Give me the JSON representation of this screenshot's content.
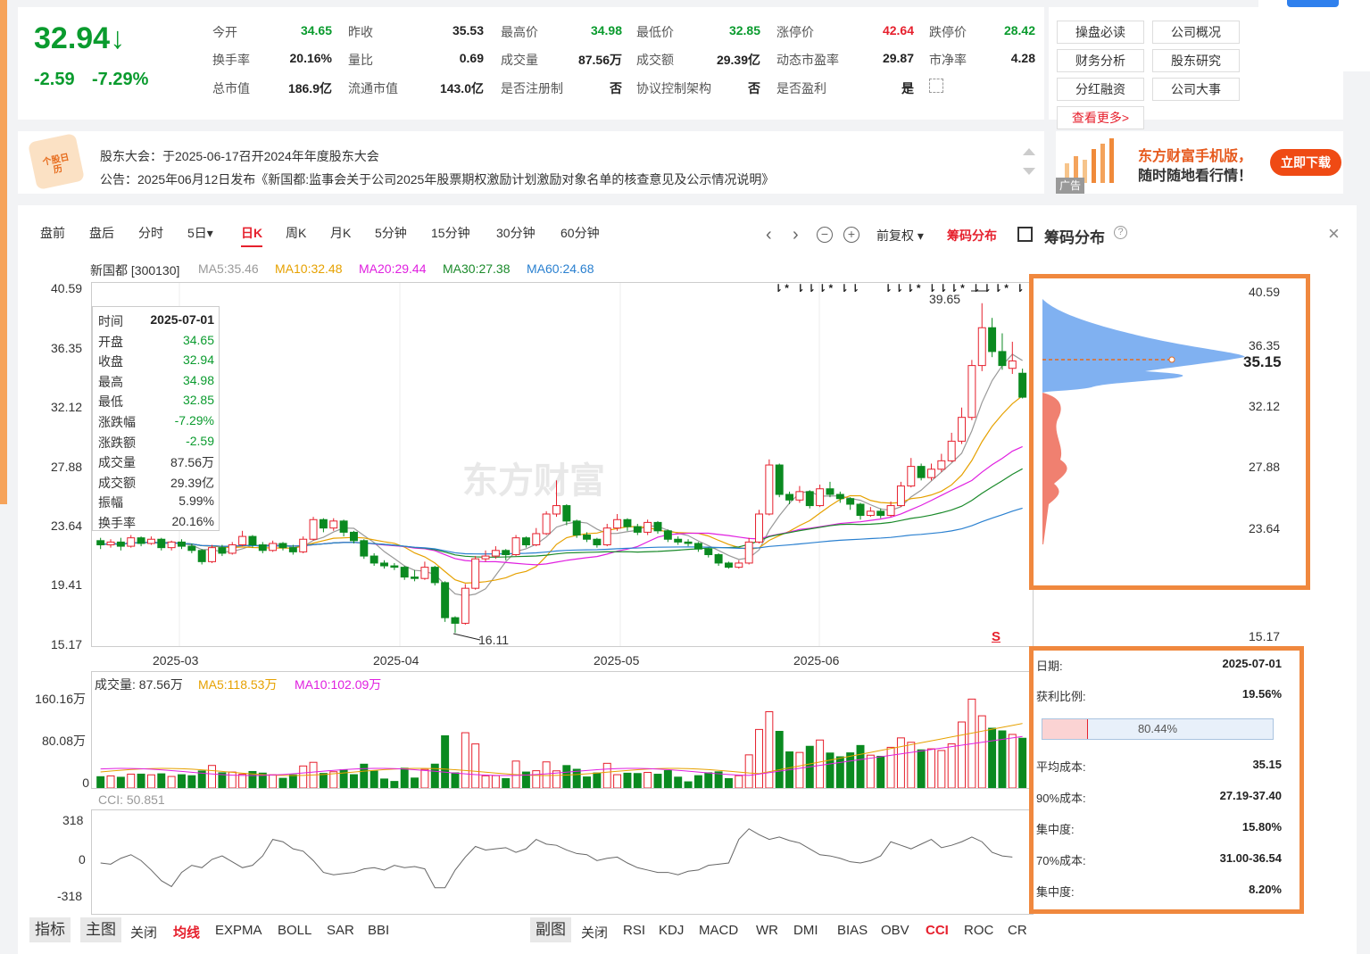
{
  "quote": {
    "price": "32.94↓",
    "change": "-2.59",
    "change_pct": "-7.29%",
    "fields": [
      {
        "label": "今开",
        "value": "34.65",
        "color": "#0a9b2e"
      },
      {
        "label": "昨收",
        "value": "35.53",
        "color": "#222"
      },
      {
        "label": "最高价",
        "value": "34.98",
        "color": "#0a9b2e"
      },
      {
        "label": "最低价",
        "value": "32.85",
        "color": "#0a9b2e"
      },
      {
        "label": "涨停价",
        "value": "42.64",
        "color": "#e6202d"
      },
      {
        "label": "跌停价",
        "value": "28.42",
        "color": "#0a9b2e"
      },
      {
        "label": "换手率",
        "value": "20.16%",
        "color": "#222"
      },
      {
        "label": "量比",
        "value": "0.69",
        "color": "#222"
      },
      {
        "label": "成交量",
        "value": "87.56万",
        "color": "#222"
      },
      {
        "label": "成交额",
        "value": "29.39亿",
        "color": "#222"
      },
      {
        "label": "动态市盈率",
        "value": "29.87",
        "color": "#222"
      },
      {
        "label": "市净率",
        "value": "4.28",
        "color": "#222"
      },
      {
        "label": "总市值",
        "value": "186.9亿",
        "color": "#222"
      },
      {
        "label": "流通市值",
        "value": "143.0亿",
        "color": "#222"
      },
      {
        "label": "是否注册制",
        "value": "否",
        "color": "#222"
      },
      {
        "label": "协议控制架构",
        "value": "否",
        "color": "#222"
      },
      {
        "label": "是否盈利",
        "value": "是",
        "color": "#222"
      }
    ]
  },
  "quick_links": [
    "操盘必读",
    "公司概况",
    "财务分析",
    "股东研究",
    "分红融资",
    "公司大事",
    "查看更多>"
  ],
  "notice": {
    "icon_text": "个股日历",
    "line1": "股东大会：于2025-06-17召开2024年年度股东大会",
    "line2": "公告：2025年06月12日发布《新国都:监事会关于公司2025年股票期权激励计划激励对象名单的核查意见及公示情况说明》"
  },
  "ad": {
    "title": "东方财富手机版，",
    "subtitle": "随时随地看行情！",
    "button": "立即下载",
    "tag": "广告"
  },
  "chart_tabs": [
    "盘前",
    "盘后",
    "分时",
    "5日▾",
    "日K",
    "周K",
    "月K",
    "5分钟",
    "15分钟",
    "30分钟",
    "60分钟"
  ],
  "active_tab": "日K",
  "chart_toolbar": {
    "adjust": "前复权 ▾",
    "chip_link": "筹码分布",
    "chip_title": "筹码分布"
  },
  "ma_legend": {
    "stock": "新国都 [300130]",
    "ma5": "MA5:35.46",
    "ma10": "MA10:32.48",
    "ma20": "MA20:29.44",
    "ma30": "MA30:27.38",
    "ma60": "MA60:24.68"
  },
  "price_axis": [
    "40.59",
    "36.35",
    "32.12",
    "27.88",
    "23.64",
    "19.41",
    "15.17"
  ],
  "date_axis": [
    "2025-03",
    "2025-04",
    "2025-05",
    "2025-06"
  ],
  "annotations": {
    "high": "39.65",
    "low": "16.11",
    "signal": "S"
  },
  "watermark": "东方财富",
  "tooltip": [
    {
      "k": "时间",
      "v": "2025-07-01",
      "c": "#222"
    },
    {
      "k": "开盘",
      "v": "34.65",
      "c": "#0a9b2e"
    },
    {
      "k": "收盘",
      "v": "32.94",
      "c": "#0a9b2e"
    },
    {
      "k": "最高",
      "v": "34.98",
      "c": "#0a9b2e"
    },
    {
      "k": "最低",
      "v": "32.85",
      "c": "#0a9b2e"
    },
    {
      "k": "涨跌幅",
      "v": "-7.29%",
      "c": "#0a9b2e"
    },
    {
      "k": "涨跌额",
      "v": "-2.59",
      "c": "#0a9b2e"
    },
    {
      "k": "成交量",
      "v": "87.56万",
      "c": "#333"
    },
    {
      "k": "成交额",
      "v": "29.39亿",
      "c": "#333"
    },
    {
      "k": "振幅",
      "v": "5.99%",
      "c": "#333"
    },
    {
      "k": "换手率",
      "v": "20.16%",
      "c": "#333"
    }
  ],
  "volume": {
    "legend": "成交量: 87.56万",
    "ma5": "MA5:118.53万",
    "ma10": "MA10:102.09万",
    "axis": [
      "160.16万",
      "80.08万",
      "0"
    ]
  },
  "cci": {
    "legend": "CCI: 50.851",
    "axis": [
      "318",
      "0",
      "-318"
    ]
  },
  "chip": {
    "axis": [
      "40.59",
      "36.35",
      "32.12",
      "27.88",
      "23.64",
      "19.41",
      "15.17"
    ],
    "avg_label": "35.15",
    "stats": [
      {
        "k": "日期:",
        "v": "2025-07-01"
      },
      {
        "k": "获利比例:",
        "v": "19.56%"
      },
      {
        "k": "平均成本:",
        "v": "35.15"
      },
      {
        "k": "90%成本:",
        "v": "27.19-37.40"
      },
      {
        "k": "集中度:",
        "v": "15.80%"
      },
      {
        "k": "70%成本:",
        "v": "31.00-36.54"
      },
      {
        "k": "集中度:",
        "v": "8.20%"
      }
    ],
    "bar_label": "80.44%"
  },
  "bottom_left": {
    "label1": "指标",
    "label2": "主图",
    "items": [
      "关闭",
      "均线",
      "EXPMA",
      "BOLL",
      "SAR",
      "BBI"
    ],
    "active": "均线"
  },
  "bottom_right": {
    "label": "副图",
    "items": [
      "关闭",
      "RSI",
      "KDJ",
      "MACD",
      "WR",
      "DMI",
      "BIAS",
      "OBV",
      "CCI",
      "ROC",
      "CR"
    ],
    "active": "CCI"
  },
  "chart_data": {
    "type": "candlestick",
    "title": "新国都 [300130]",
    "ylim": [
      15.17,
      40.59
    ],
    "x_range": [
      "2025-02-17",
      "2025-07-01"
    ],
    "candles": [
      [
        22.7,
        22.4,
        22.9,
        22.1
      ],
      [
        22.4,
        22.6,
        22.8,
        22.2
      ],
      [
        22.6,
        22.3,
        22.9,
        22.0
      ],
      [
        22.3,
        22.9,
        23.1,
        22.2
      ],
      [
        22.9,
        22.5,
        23.0,
        22.3
      ],
      [
        22.5,
        22.8,
        23.0,
        22.4
      ],
      [
        22.8,
        22.2,
        22.9,
        22.0
      ],
      [
        22.2,
        22.6,
        22.7,
        22.0
      ],
      [
        22.6,
        22.3,
        22.8,
        22.1
      ],
      [
        22.3,
        22.0,
        22.5,
        21.8
      ],
      [
        22.0,
        21.2,
        22.1,
        21.0
      ],
      [
        21.2,
        22.2,
        22.4,
        21.1
      ],
      [
        22.2,
        21.8,
        22.4,
        21.6
      ],
      [
        21.8,
        22.4,
        22.6,
        21.7
      ],
      [
        22.4,
        23.0,
        23.4,
        22.3
      ],
      [
        23.0,
        22.4,
        23.1,
        22.2
      ],
      [
        22.4,
        22.0,
        22.6,
        21.8
      ],
      [
        22.0,
        22.5,
        22.7,
        21.9
      ],
      [
        22.5,
        22.2,
        22.6,
        22.0
      ],
      [
        22.2,
        21.9,
        22.4,
        21.7
      ],
      [
        21.9,
        22.8,
        23.0,
        21.8
      ],
      [
        22.8,
        24.2,
        24.4,
        22.7
      ],
      [
        24.2,
        23.6,
        24.3,
        23.3
      ],
      [
        23.6,
        24.1,
        24.3,
        23.4
      ],
      [
        24.1,
        23.3,
        24.2,
        23.0
      ],
      [
        23.3,
        22.7,
        23.4,
        22.5
      ],
      [
        22.7,
        21.6,
        22.8,
        21.4
      ],
      [
        21.6,
        21.1,
        21.8,
        20.9
      ],
      [
        21.1,
        20.9,
        21.3,
        20.7
      ],
      [
        20.9,
        20.8,
        21.1,
        20.6
      ],
      [
        20.8,
        20.1,
        20.9,
        19.9
      ],
      [
        20.1,
        20.0,
        20.6,
        19.8
      ],
      [
        20.0,
        20.8,
        21.2,
        19.9
      ],
      [
        20.8,
        19.7,
        20.9,
        19.5
      ],
      [
        19.7,
        17.2,
        19.8,
        16.9
      ],
      [
        17.2,
        16.8,
        17.3,
        16.11
      ],
      [
        16.8,
        19.3,
        19.6,
        16.7
      ],
      [
        19.3,
        21.4,
        21.6,
        19.2
      ],
      [
        21.4,
        21.6,
        22.0,
        21.2
      ],
      [
        21.6,
        22.0,
        22.3,
        21.4
      ],
      [
        22.0,
        21.7,
        22.1,
        21.3
      ],
      [
        21.7,
        22.9,
        23.1,
        21.6
      ],
      [
        22.9,
        22.4,
        23.0,
        22.2
      ],
      [
        22.4,
        23.2,
        23.6,
        22.3
      ],
      [
        23.2,
        24.6,
        24.8,
        23.1
      ],
      [
        24.6,
        25.2,
        27.0,
        24.4
      ],
      [
        25.2,
        24.1,
        25.3,
        23.8
      ],
      [
        24.1,
        23.1,
        24.2,
        22.9
      ],
      [
        23.1,
        22.8,
        23.3,
        22.6
      ],
      [
        22.8,
        22.4,
        22.9,
        22.2
      ],
      [
        22.4,
        23.6,
        23.9,
        22.3
      ],
      [
        23.6,
        24.2,
        24.6,
        23.4
      ],
      [
        24.2,
        23.7,
        24.3,
        23.4
      ],
      [
        23.7,
        23.3,
        23.9,
        23.1
      ],
      [
        23.3,
        24.0,
        24.2,
        23.1
      ],
      [
        24.0,
        23.4,
        24.1,
        23.2
      ],
      [
        23.4,
        22.8,
        23.5,
        22.6
      ],
      [
        22.8,
        22.6,
        23.0,
        22.4
      ],
      [
        22.6,
        22.5,
        22.8,
        22.3
      ],
      [
        22.5,
        22.1,
        22.6,
        21.9
      ],
      [
        22.1,
        21.7,
        22.2,
        21.5
      ],
      [
        21.7,
        21.1,
        21.8,
        20.9
      ],
      [
        21.1,
        20.8,
        21.2,
        20.7
      ],
      [
        20.8,
        21.1,
        21.3,
        20.7
      ],
      [
        21.1,
        22.6,
        22.9,
        21.0
      ],
      [
        22.6,
        24.6,
        24.9,
        22.5
      ],
      [
        24.6,
        28.1,
        28.5,
        24.5
      ],
      [
        28.1,
        26.0,
        28.2,
        25.8
      ],
      [
        26.0,
        25.6,
        26.2,
        25.3
      ],
      [
        25.6,
        26.2,
        26.6,
        25.4
      ],
      [
        26.2,
        25.2,
        26.3,
        25.0
      ],
      [
        25.2,
        26.4,
        26.7,
        25.1
      ],
      [
        26.4,
        26.0,
        26.9,
        25.8
      ],
      [
        26.0,
        25.7,
        26.2,
        25.4
      ],
      [
        25.7,
        25.3,
        25.8,
        24.9
      ],
      [
        25.3,
        24.5,
        25.4,
        24.2
      ],
      [
        24.5,
        24.8,
        25.1,
        24.4
      ],
      [
        24.8,
        24.5,
        25.0,
        24.3
      ],
      [
        24.5,
        25.2,
        25.5,
        24.4
      ],
      [
        25.2,
        26.6,
        26.9,
        25.1
      ],
      [
        26.6,
        28.0,
        28.6,
        26.5
      ],
      [
        28.0,
        27.2,
        28.2,
        27.0
      ],
      [
        27.2,
        27.8,
        28.2,
        27.0
      ],
      [
        27.8,
        28.4,
        28.9,
        27.6
      ],
      [
        28.4,
        29.8,
        30.4,
        28.3
      ],
      [
        29.8,
        31.5,
        32.2,
        29.6
      ],
      [
        31.5,
        35.2,
        35.6,
        31.3
      ],
      [
        35.2,
        37.9,
        39.65,
        34.8
      ],
      [
        37.9,
        36.2,
        38.6,
        35.8
      ],
      [
        36.2,
        35.2,
        37.5,
        34.9
      ],
      [
        35.0,
        35.53,
        36.9,
        34.6
      ],
      [
        34.65,
        32.94,
        34.98,
        32.85
      ]
    ],
    "volume_axis_max": 160.16,
    "cci_axis": [
      -318,
      318
    ]
  }
}
